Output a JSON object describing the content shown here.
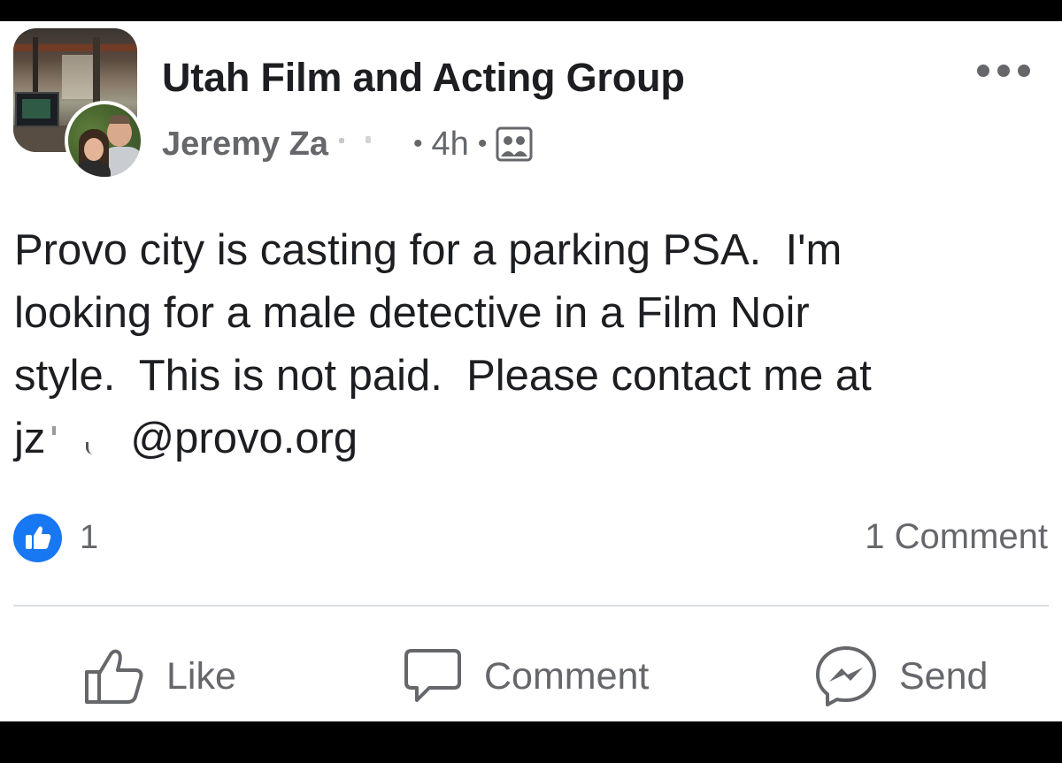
{
  "post": {
    "group_name": "Utah Film and Acting Group",
    "author": "Jeremy Za",
    "timestamp": "4h",
    "separator": "•",
    "audience_icon": "group-audience-icon",
    "body_lines": [
      "Provo city is casting for a parking PSA.  I'm",
      "looking for a male detective in a Film Noir",
      "style.  This is not paid.  Please contact me at"
    ],
    "email_prefix": "jz",
    "email_suffix": "@provo.org"
  },
  "reactions": {
    "icon": "thumbs-up-icon",
    "count": "1",
    "comments_label": "1 Comment"
  },
  "actions": {
    "like": "Like",
    "comment": "Comment",
    "send": "Send"
  },
  "colors": {
    "accent": "#1877f2",
    "text_primary": "#1c1e21",
    "text_secondary": "#65676b",
    "divider": "#dadde1"
  }
}
